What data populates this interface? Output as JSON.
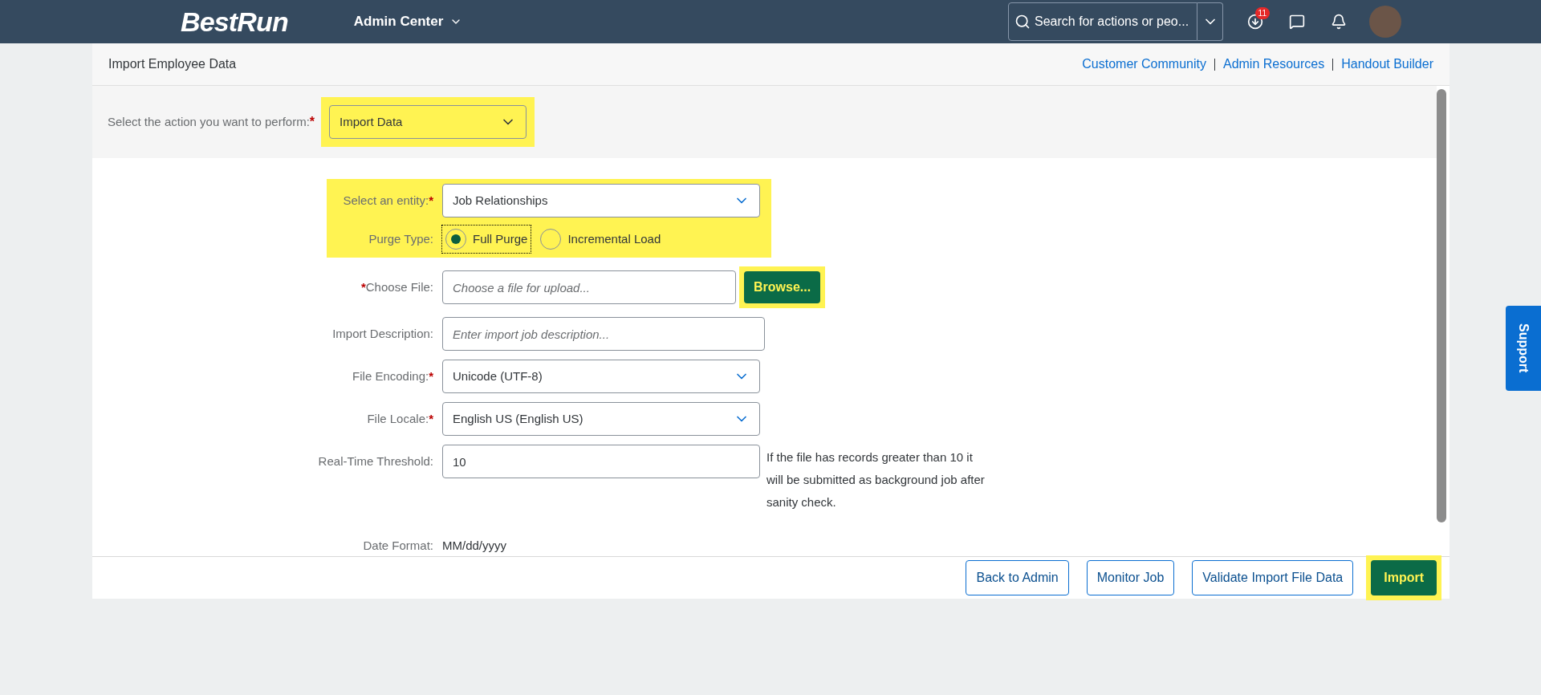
{
  "header": {
    "logo": "BestRun",
    "menu": "Admin Center",
    "search": {
      "placeholder": "Search for actions or peo..."
    },
    "notification_count": "11"
  },
  "page": {
    "title": "Import Employee Data",
    "links": [
      "Customer Community",
      "Admin Resources",
      "Handout Builder"
    ]
  },
  "action": {
    "label": "Select the action you want to perform:",
    "required_mark": "*",
    "value": "Import Data",
    "highlighted": true
  },
  "fields": [
    {
      "kind": "select",
      "label": "Select an entity:",
      "required_mark": "*",
      "value": "Job Relationships",
      "highlighted": true
    },
    {
      "kind": "radio",
      "label": "Purge Type:",
      "highlighted": true,
      "options": [
        {
          "label": "Full Purge",
          "selected": true
        },
        {
          "label": "Incremental Load",
          "selected": false
        }
      ]
    },
    {
      "kind": "file",
      "label": "Choose File:",
      "required_mark": "*",
      "placeholder": "Choose a file for upload...",
      "button": "Browse...",
      "highlighted": true
    },
    {
      "kind": "text",
      "label": "Import Description:",
      "placeholder": "Enter import job description...",
      "highlighted": false
    },
    {
      "kind": "select",
      "label": "File Encoding:",
      "required_mark": "*",
      "value": "Unicode (UTF-8)",
      "highlighted": false
    },
    {
      "kind": "select",
      "label": "File Locale:",
      "required_mark": "*",
      "value": "English US (English US)",
      "highlighted": false
    },
    {
      "kind": "text",
      "label": "Real-Time Threshold:",
      "value": "10",
      "note": "If the file has records greater than 10 it will be submitted as background job after sanity check.",
      "highlighted": false
    },
    {
      "kind": "info",
      "label": "Date Format:",
      "value": "MM/dd/yyyy",
      "highlighted": false
    }
  ],
  "footer_buttons": [
    {
      "label": "Back to Admin",
      "kind": "secondary",
      "highlighted": false
    },
    {
      "label": "Monitor Job",
      "kind": "secondary",
      "highlighted": false
    },
    {
      "label": "Validate Import File Data",
      "kind": "secondary",
      "highlighted": false
    },
    {
      "label": "Import",
      "kind": "primary",
      "highlighted": true
    }
  ],
  "support": "Support"
}
